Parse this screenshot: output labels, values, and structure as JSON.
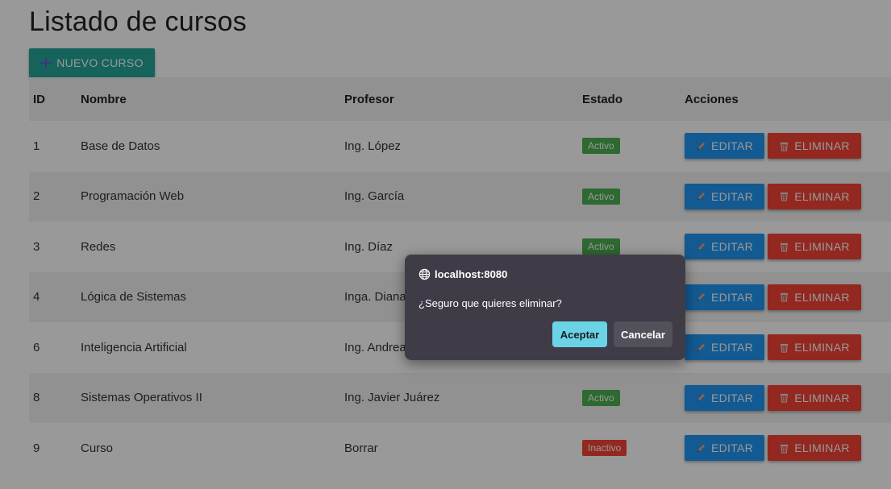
{
  "page": {
    "title": "Listado de cursos"
  },
  "toolbar": {
    "new_label": "NUEVO CURSO",
    "new_icon": "plus-icon"
  },
  "table": {
    "headers": {
      "id": "ID",
      "nombre": "Nombre",
      "profesor": "Profesor",
      "estado": "Estado",
      "acciones": "Acciones"
    },
    "rows": [
      {
        "id": "1",
        "nombre": "Base de Datos",
        "profesor": "Ing. López",
        "estado": "Activo",
        "edit": "EDITAR",
        "delete": "ELIMINAR"
      },
      {
        "id": "2",
        "nombre": "Programación Web",
        "profesor": "Ing. García",
        "estado": "Activo",
        "edit": "EDITAR",
        "delete": "ELIMINAR"
      },
      {
        "id": "3",
        "nombre": "Redes",
        "profesor": "Ing. Díaz",
        "estado": "Activo",
        "edit": "EDITAR",
        "delete": "ELIMINAR"
      },
      {
        "id": "4",
        "nombre": "Lógica de Sistemas",
        "profesor": "Inga. Diana A",
        "estado": "",
        "edit": "EDITAR",
        "delete": "ELIMINAR"
      },
      {
        "id": "6",
        "nombre": "Inteligencia Artificial",
        "profesor": "Ing. Andrea",
        "estado": "",
        "edit": "EDITAR",
        "delete": "ELIMINAR"
      },
      {
        "id": "8",
        "nombre": "Sistemas Operativos II",
        "profesor": "Ing. Javier Juárez",
        "estado": "Activo",
        "edit": "EDITAR",
        "delete": "ELIMINAR"
      },
      {
        "id": "9",
        "nombre": "Curso",
        "profesor": "Borrar",
        "estado": "Inactivo",
        "edit": "EDITAR",
        "delete": "ELIMINAR"
      }
    ]
  },
  "dialog": {
    "origin": "localhost:8080",
    "message": "¿Seguro que quieres eliminar?",
    "ok_label": "Aceptar",
    "cancel_label": "Cancelar"
  },
  "colors": {
    "new_button": "#26a69a",
    "edit_button": "#2196f3",
    "delete_button": "#f44336",
    "badge_active": "#4caf50",
    "badge_inactive": "#f44336",
    "dialog_bg": "#3f3c47",
    "dialog_ok": "#6ad3e6"
  },
  "icons": {
    "edit": "pencil-icon",
    "delete": "trash-icon",
    "origin": "globe-icon"
  }
}
